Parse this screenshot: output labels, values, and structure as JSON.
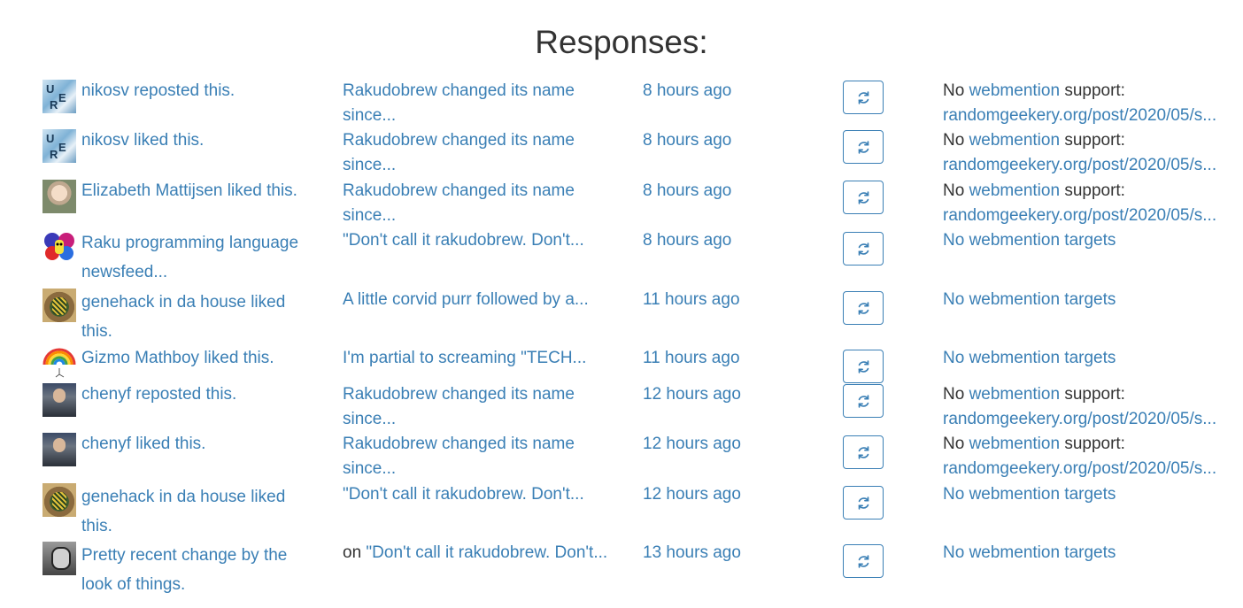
{
  "heading": "Responses:",
  "colors": {
    "link": "#3a7fb5",
    "text": "#333333"
  },
  "responses": [
    {
      "avatar_icon": "puzzle-avatar",
      "who": "nikosv reposted this.",
      "post_prefix": "",
      "post": "Rakudobrew changed its name since...",
      "time": "8 hours ago",
      "wm_no": "No",
      "wm_link": "webmention",
      "wm_support": "support:",
      "wm_url": "randomgeekery.org/post/2020/05/s...",
      "wm_targets": ""
    },
    {
      "avatar_icon": "puzzle-avatar",
      "who": "nikosv liked this.",
      "post_prefix": "",
      "post": "Rakudobrew changed its name since...",
      "time": "8 hours ago",
      "wm_no": "No",
      "wm_link": "webmention",
      "wm_support": "support:",
      "wm_url": "randomgeekery.org/post/2020/05/s...",
      "wm_targets": ""
    },
    {
      "avatar_icon": "person-avatar",
      "who": "Elizabeth Mattijsen liked this.",
      "post_prefix": "",
      "post": "Rakudobrew changed its name since...",
      "time": "8 hours ago",
      "wm_no": "No",
      "wm_link": "webmention",
      "wm_support": "support:",
      "wm_url": "randomgeekery.org/post/2020/05/s...",
      "wm_targets": ""
    },
    {
      "avatar_icon": "butterfly-avatar",
      "who": "Raku programming language newsfeed...",
      "post_prefix": "",
      "post": "\"Don't call it rakudobrew. Don't...",
      "time": "8 hours ago",
      "wm_no": "",
      "wm_link": "",
      "wm_support": "",
      "wm_url": "",
      "wm_targets": "No webmention targets"
    },
    {
      "avatar_icon": "camera-avatar",
      "who": "genehack in da house liked this.",
      "post_prefix": "",
      "post": "A little corvid purr followed by a...",
      "time": "11 hours ago",
      "wm_no": "",
      "wm_link": "",
      "wm_support": "",
      "wm_url": "",
      "wm_targets": "No webmention targets"
    },
    {
      "avatar_icon": "rainbow-avatar",
      "who": "Gizmo Mathboy liked this.",
      "post_prefix": "",
      "post": "I'm partial to screaming \"TECH...",
      "time": "11 hours ago",
      "wm_no": "",
      "wm_link": "",
      "wm_support": "",
      "wm_url": "",
      "wm_targets": "No webmention targets"
    },
    {
      "avatar_icon": "person-avatar",
      "who": "chenyf reposted this.",
      "post_prefix": "",
      "post": "Rakudobrew changed its name since...",
      "time": "12 hours ago",
      "wm_no": "No",
      "wm_link": "webmention",
      "wm_support": "support:",
      "wm_url": "randomgeekery.org/post/2020/05/s...",
      "wm_targets": ""
    },
    {
      "avatar_icon": "person-avatar",
      "who": "chenyf liked this.",
      "post_prefix": "",
      "post": "Rakudobrew changed its name since...",
      "time": "12 hours ago",
      "wm_no": "No",
      "wm_link": "webmention",
      "wm_support": "support:",
      "wm_url": "randomgeekery.org/post/2020/05/s...",
      "wm_targets": ""
    },
    {
      "avatar_icon": "camera-avatar",
      "who": "genehack in da house liked this.",
      "post_prefix": "",
      "post": "\"Don't call it rakudobrew. Don't...",
      "time": "12 hours ago",
      "wm_no": "",
      "wm_link": "",
      "wm_support": "",
      "wm_url": "",
      "wm_targets": "No webmention targets"
    },
    {
      "avatar_icon": "person-avatar",
      "who": "Pretty recent change by the look of things.",
      "post_prefix": "on",
      "post": "\"Don't call it rakudobrew. Don't...",
      "time": "13 hours ago",
      "wm_no": "",
      "wm_link": "",
      "wm_support": "",
      "wm_url": "",
      "wm_targets": "No webmention targets"
    }
  ]
}
